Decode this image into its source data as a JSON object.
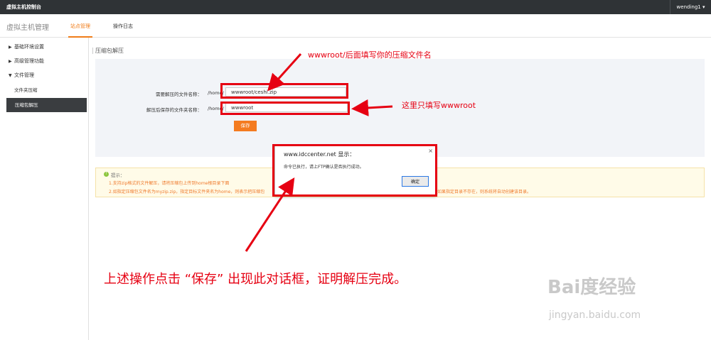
{
  "topbar": {
    "brand": "虚拟主机控制台",
    "user": "wending1 ▾"
  },
  "subbar": {
    "title": "虚拟主机管理",
    "tabs": [
      {
        "label": "站点管理",
        "active": true
      },
      {
        "label": "操作日志",
        "active": false
      }
    ]
  },
  "sidebar": {
    "items": [
      {
        "label": "基础环境设置",
        "arrow": "▶"
      },
      {
        "label": "高级管理功能",
        "arrow": "▶"
      },
      {
        "label": "文件管理",
        "arrow": "▼"
      }
    ],
    "subitems": [
      {
        "label": "文件夹压缩"
      },
      {
        "label": "压缩包解压",
        "active": true
      }
    ]
  },
  "content": {
    "title": "压缩包解压"
  },
  "form": {
    "archive_label": "需要解压的文件名称：",
    "archive_prefix": "/home/",
    "archive_value": "wwwroot/ceshi.zip",
    "target_label": "解压后保存的文件夹名称：",
    "target_prefix": "/home/",
    "target_value": "wwwroot",
    "save_label": "保存"
  },
  "tips": {
    "heading": "提示：",
    "icon": "!",
    "line1": "1.支持zip格式的文件解压，请将压缩包上传到home根目录下面",
    "line2": "2.如指定压缩包文件名为myzip.zip，指定目标文件夹名为home，则表示把压缩包",
    "line2_end": "如果指定目录不存在，则系统将自动创建该目录。"
  },
  "dialog": {
    "title": "www.idccenter.net 显示：",
    "close": "×",
    "message": "命令已执行，请上FTP确认是否执行成功。",
    "ok_label": "确定"
  },
  "annotations": {
    "top": "wwwroot/后面填写你的压缩文件名",
    "right": "这里只填写wwwroot",
    "bottom": "上述操作点击 “保存” 出现此对话框，证明解压完成。"
  },
  "watermark": {
    "logo": "Bai度经验",
    "url": "jingyan.baidu.com"
  },
  "colors": {
    "accent": "#f07d19",
    "annotation": "#e60012",
    "topbar": "#2f3336"
  }
}
